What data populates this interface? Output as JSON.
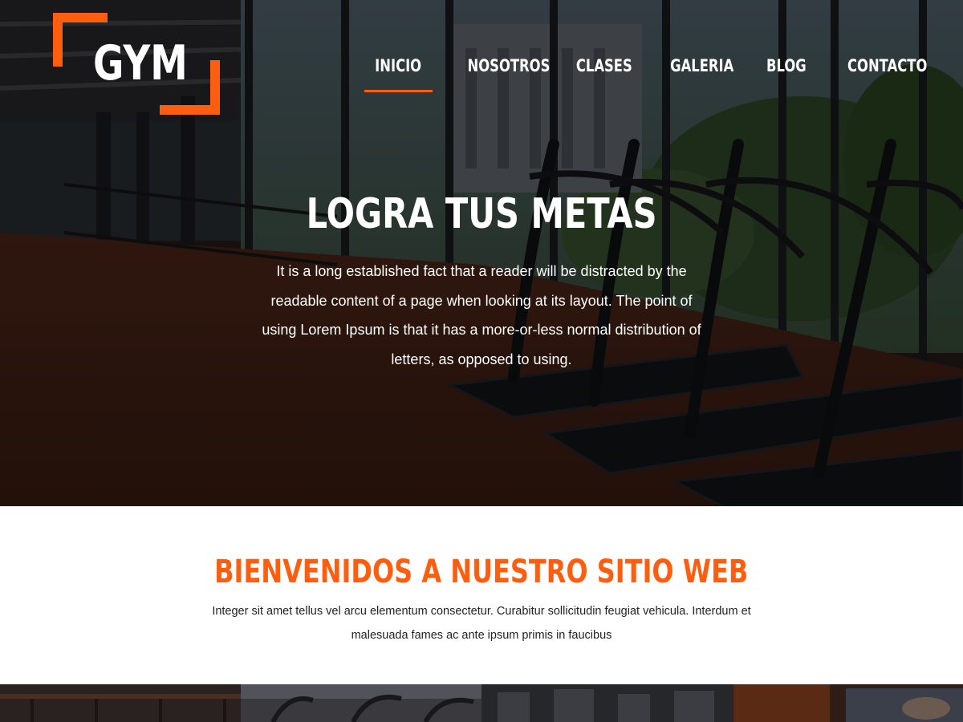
{
  "brand": {
    "logo_text": "GYM",
    "accent_color": "#ff5e0e"
  },
  "nav": {
    "items": [
      {
        "label": "INICIO",
        "active": true
      },
      {
        "label": "NOSOTROS",
        "active": false
      },
      {
        "label": "CLASES",
        "active": false
      },
      {
        "label": "GALERIA",
        "active": false
      },
      {
        "label": "BLOG",
        "active": false
      },
      {
        "label": "CONTACTO",
        "active": false
      }
    ]
  },
  "hero": {
    "title": "LOGRA TUS METAS",
    "description": "It is a long established fact that a reader will be distracted by the readable content of a page when looking at its layout. The point of using Lorem Ipsum is that it has a more-or-less normal distribution of letters, as opposed to using."
  },
  "welcome": {
    "title": "BIENVENIDOS A NUESTRO SITIO WEB",
    "text": "Integer sit amet tellus vel arcu elementum consectetur. Curabitur sollicitudin feugiat vehicula. Interdum et malesuada fames ac ante ipsum primis in faucibus"
  }
}
